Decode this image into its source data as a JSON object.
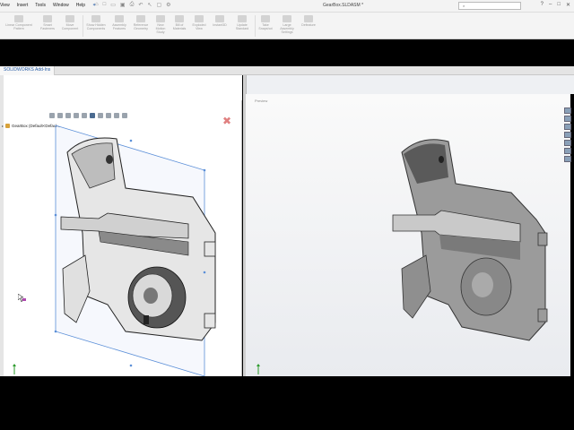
{
  "menu": [
    "View",
    "Insert",
    "Tools",
    "Window",
    "Help"
  ],
  "doc_title": "GearBox.SLDASM *",
  "search_placeholder": "",
  "ribbon": [
    {
      "label": "Linear Component Pattern"
    },
    {
      "label": "Smart Fasteners"
    },
    {
      "label": "Move Component"
    },
    {
      "label": "Show Hidden Components"
    },
    {
      "label": "Assembly Features"
    },
    {
      "label": "Reference Geometry"
    },
    {
      "label": "New Motion Study"
    },
    {
      "label": "Bill of Materials"
    },
    {
      "label": "Exploded View"
    },
    {
      "label": "Instant3D"
    },
    {
      "label": "Update Standard"
    },
    {
      "label": "Take Snapshot"
    },
    {
      "label": "Large Assembly Settings"
    },
    {
      "label": "Defeature"
    }
  ],
  "tab_label": "SOLIDWORKS Add-Ins",
  "tree_root": "GearBox (Default<Defaul...",
  "left_view_label": "",
  "right_view_label": "Preview",
  "colors": {
    "accent": "#2a5fa8",
    "preview_box": "#5b8fd8",
    "close": "#e08080"
  }
}
